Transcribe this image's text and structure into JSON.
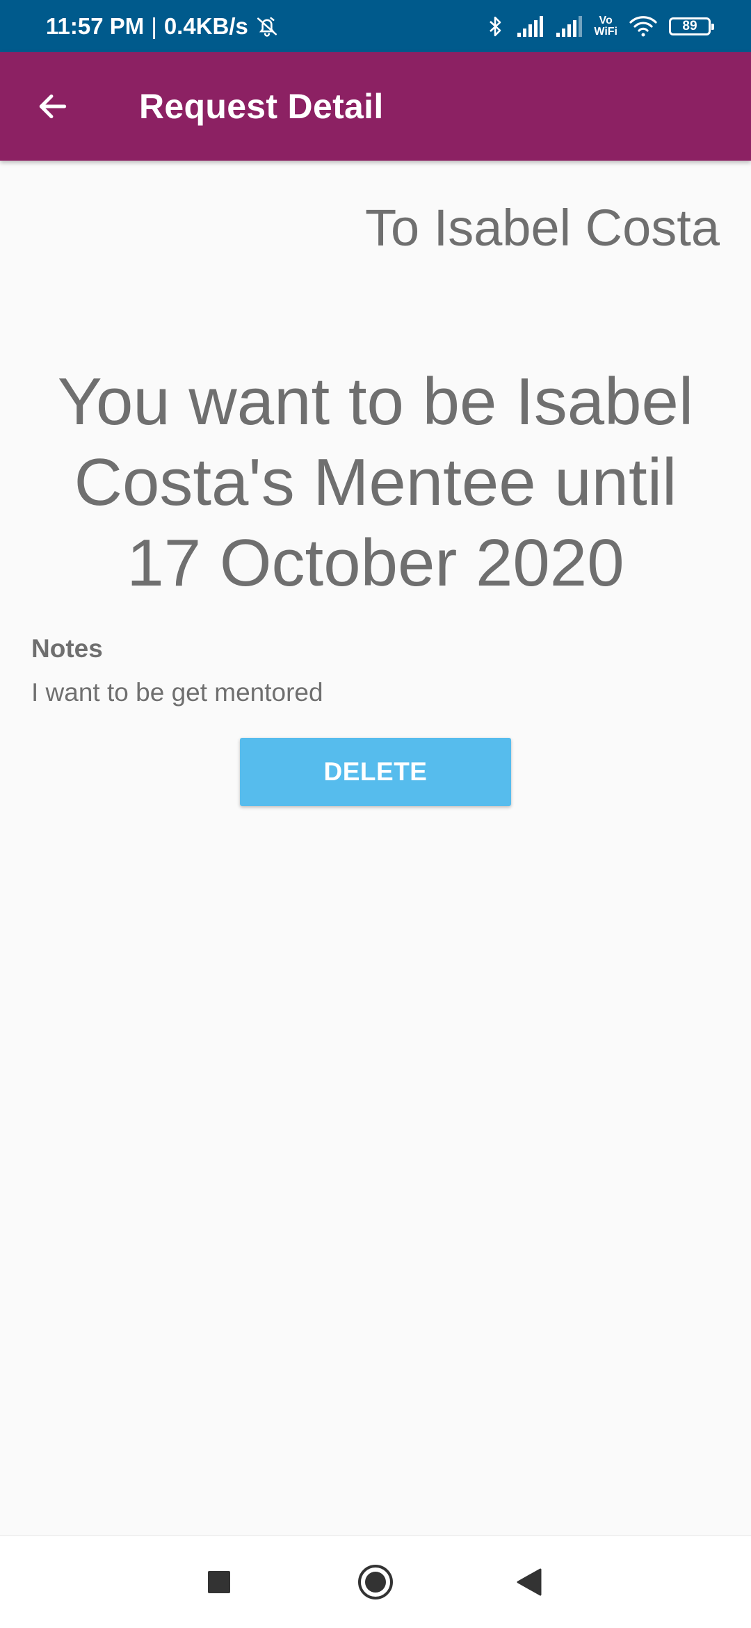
{
  "status_bar": {
    "time": "11:57 PM",
    "separator": "|",
    "net_speed": "0.4KB/s",
    "vowifi_top": "Vo",
    "vowifi_bottom": "WiFi",
    "battery": "89",
    "icons": [
      "alarm-off-icon",
      "bluetooth-icon",
      "signal-icon",
      "signal-icon",
      "vowifi-icon",
      "wifi-icon",
      "battery-icon"
    ]
  },
  "app_bar": {
    "title": "Request Detail",
    "back_icon": "arrow-back-icon",
    "background": "#8c2163"
  },
  "request": {
    "recipient": "To Isabel Costa",
    "headline": "You want to be Isabel Costa's Mentee until 17 October 2020",
    "notes_label": "Notes",
    "notes_text": "I want to be get mentored",
    "delete_label": "DELETE",
    "delete_color": "#56bced"
  },
  "nav_bar": {
    "icons": [
      "recents-square-icon",
      "home-circle-icon",
      "back-triangle-icon"
    ]
  }
}
